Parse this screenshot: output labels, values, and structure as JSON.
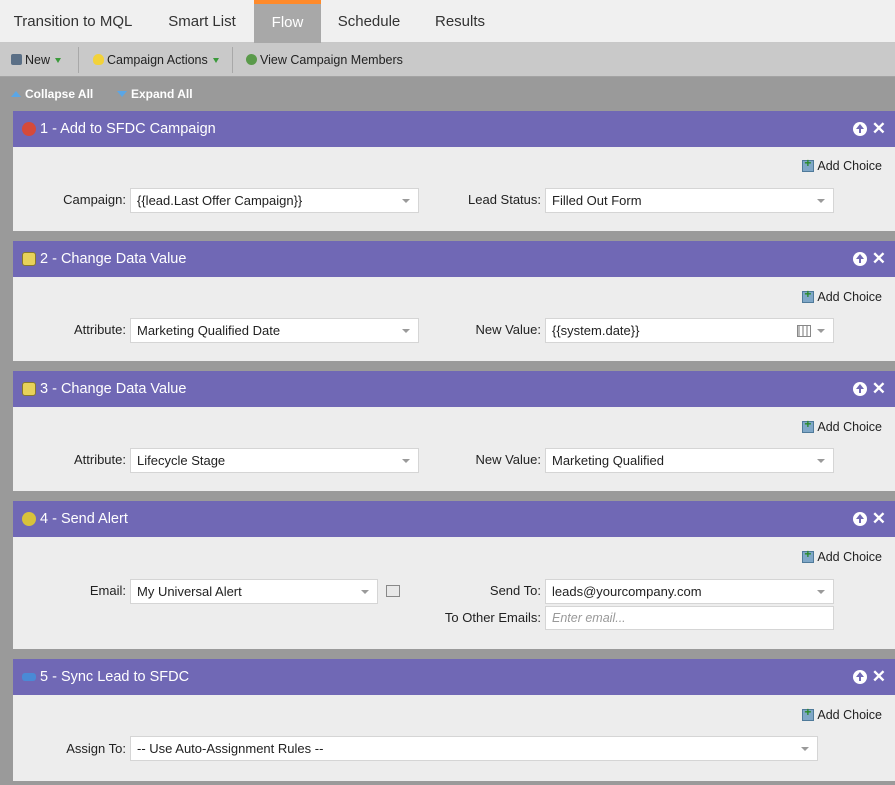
{
  "tabs": [
    {
      "label": "Transition to MQL"
    },
    {
      "label": "Smart List"
    },
    {
      "label": "Flow"
    },
    {
      "label": "Schedule"
    },
    {
      "label": "Results"
    }
  ],
  "toolbar": {
    "new_label": "New",
    "campaign_actions_label": "Campaign Actions",
    "view_members_label": "View Campaign Members"
  },
  "controls": {
    "collapse_all": "Collapse All",
    "expand_all": "Expand All"
  },
  "add_choice_label": "Add Choice",
  "steps": [
    {
      "title": "1 - Add to SFDC Campaign",
      "field1_label": "Campaign:",
      "field1_value": "{{lead.Last Offer Campaign}}",
      "field2_label": "Lead Status:",
      "field2_value": "Filled Out Form"
    },
    {
      "title": "2 - Change Data Value",
      "field1_label": "Attribute:",
      "field1_value": "Marketing Qualified Date",
      "field2_label": "New Value:",
      "field2_value": "{{system.date}}"
    },
    {
      "title": "3 - Change Data Value",
      "field1_label": "Attribute:",
      "field1_value": "Lifecycle Stage",
      "field2_label": "New Value:",
      "field2_value": "Marketing Qualified"
    },
    {
      "title": "4 - Send Alert",
      "field1_label": "Email:",
      "field1_value": "My Universal Alert",
      "field2_label": "Send To:",
      "field2_value": "leads@yourcompany.com",
      "field3_label": "To Other Emails:",
      "field3_placeholder": "Enter email..."
    },
    {
      "title": "5 - Sync Lead to SFDC",
      "field1_label": "Assign To:",
      "field1_value": "-- Use Auto-Assignment Rules --"
    }
  ],
  "colors": {
    "step_header": "#7068b5",
    "active_tab_accent": "#ff8a2a"
  }
}
